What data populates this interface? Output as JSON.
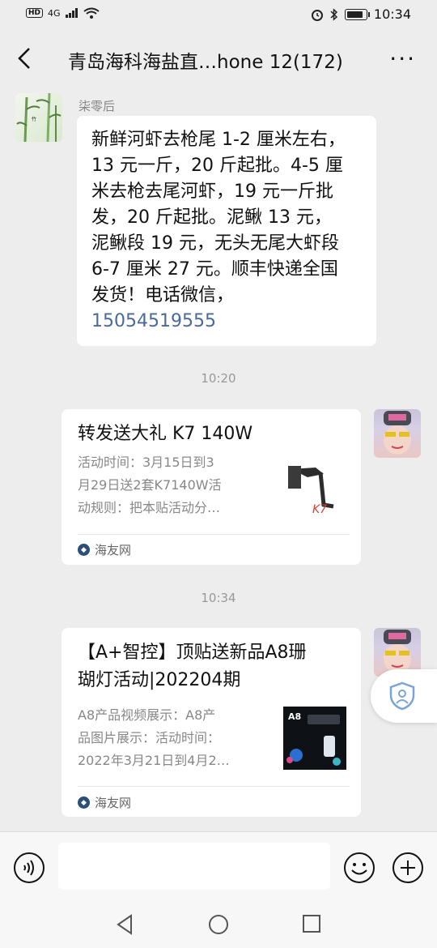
{
  "status_bar": {
    "left_badge": "HD",
    "network": "4G",
    "time": "10:34",
    "battery_level": 0.85
  },
  "header": {
    "title": "青岛海科海盐直…hone 12(172)",
    "more_label": "···"
  },
  "messages": [
    {
      "sender": "柒零后",
      "text_lines": [
        "新鲜河虾去枪尾 1-2 厘米左右，",
        "13 元一斤，20 斤起批。4-5 厘",
        "米去枪去尾河虾，19 元一斤批",
        "发，20 斤起批。泥鳅 13 元，",
        "泥鳅段 19 元，无头无尾大虾段",
        "6-7 厘米 27 元。顺丰快递全国",
        "发货！电话微信，"
      ],
      "phone": "15054519555"
    }
  ],
  "timestamps": [
    "10:20",
    "10:34"
  ],
  "cards": [
    {
      "title": "转发送大礼  K7 140W",
      "desc_lines": [
        "活动时间：3月15日到3",
        "月29日送2套K7140W活",
        "动规则：把本贴活动分…"
      ],
      "source": "海友网",
      "thumb_text": "K7"
    },
    {
      "title_lines": [
        "【A+智控】顶贴送新品A8珊",
        "瑚灯活动|202204期"
      ],
      "desc_lines": [
        "A8产品视频展示：A8产",
        "品图片展示：活动时间：",
        "2022年3月21日到4月2…"
      ],
      "source": "海友网",
      "thumb_text": "A8"
    }
  ],
  "icons": {
    "back": "chevron-left-icon",
    "voice": "voice-icon",
    "emoji": "emoji-icon",
    "plus": "plus-icon",
    "float": "shield-icon"
  }
}
